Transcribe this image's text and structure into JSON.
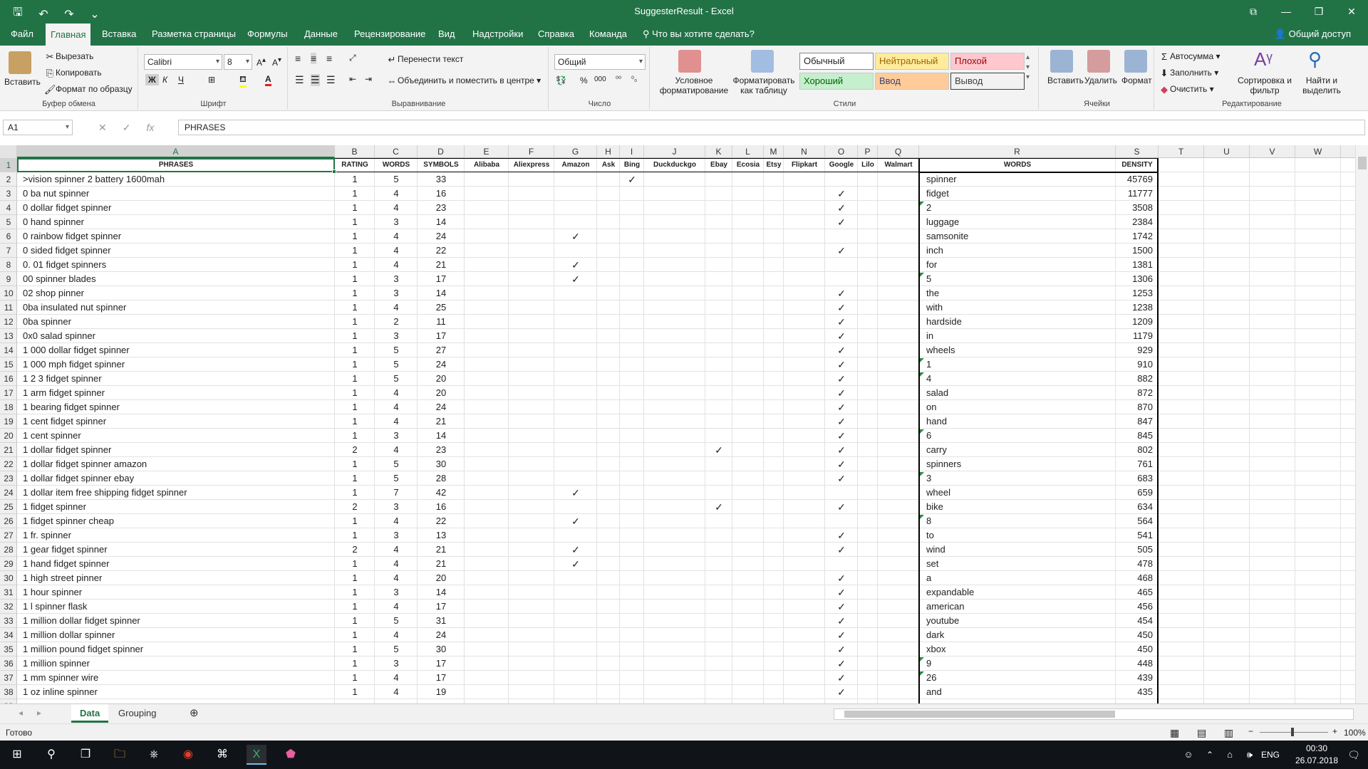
{
  "title": "SuggesterResult  -  Excel",
  "qat": {
    "save": "🖫",
    "undo": "↶",
    "redo": "↷",
    "customize": "⌄"
  },
  "window_controls": [
    "⧉",
    "—",
    "❐",
    "✕"
  ],
  "menu": {
    "tabs": [
      "Файл",
      "Главная",
      "Вставка",
      "Разметка страницы",
      "Формулы",
      "Данные",
      "Рецензирование",
      "Вид",
      "Надстройки",
      "Справка",
      "Команда"
    ],
    "active": "Главная",
    "tell_me": "Что вы хотите сделать?",
    "share": "Общий доступ"
  },
  "ribbon": {
    "clipboard": {
      "label": "Буфер обмена",
      "paste": "Вставить",
      "cut": "Вырезать",
      "copy": "Копировать",
      "format_painter": "Формат по образцу"
    },
    "font": {
      "label": "Шрифт",
      "name": "Calibri",
      "size": "8",
      "bold": "Ж",
      "italic": "К",
      "underline": "Ч"
    },
    "alignment": {
      "label": "Выравнивание",
      "wrap": "Перенести текст",
      "merge": "Объединить и поместить в центре"
    },
    "number": {
      "label": "Число",
      "format": "Общий"
    },
    "styles": {
      "label": "Стили",
      "conditional": "Условное форматирование",
      "as_table": "Форматировать как таблицу",
      "normal": "Обычный",
      "neutral": "Нейтральный",
      "bad": "Плохой",
      "good": "Хороший",
      "input": "Ввод",
      "output": "Вывод"
    },
    "cells": {
      "label": "Ячейки",
      "insert": "Вставить",
      "delete": "Удалить",
      "format": "Формат"
    },
    "editing": {
      "label": "Редактирование",
      "autosum": "Автосумма",
      "fill": "Заполнить",
      "clear": "Очистить",
      "sort": "Сортировка и фильтр",
      "find": "Найти и выделить"
    }
  },
  "name_box": "A1",
  "formula_value": "PHRASES",
  "columns": [
    "A",
    "B",
    "C",
    "D",
    "E",
    "F",
    "G",
    "H",
    "I",
    "J",
    "K",
    "L",
    "M",
    "N",
    "O",
    "P",
    "Q",
    "R",
    "S",
    "T",
    "U",
    "V",
    "W"
  ],
  "headers": {
    "A": "PHRASES",
    "B": "RATING",
    "C": "WORDS",
    "D": "SYMBOLS",
    "E": "Alibaba",
    "F": "Aliexpress",
    "G": "Amazon",
    "H": "Ask",
    "I": "Bing",
    "J": "Duckduckgo",
    "K": "Ebay",
    "L": "Ecosia",
    "M": "Etsy",
    "N": "Flipkart",
    "O": "Google",
    "P": "Lilo",
    "Q": "Walmart",
    "R": "WORDS",
    "S": "DENSITY"
  },
  "check_mark": "✓",
  "rows": [
    {
      "phrase": ">vision spinner 2 battery 1600mah",
      "rating": "1",
      "words": "5",
      "symbols": "33",
      "checks": [
        "I"
      ],
      "word": "spinner",
      "density": "45769"
    },
    {
      "phrase": "0 ba nut spinner",
      "rating": "1",
      "words": "4",
      "symbols": "16",
      "checks": [
        "O"
      ],
      "word": "fidget",
      "density": "11777"
    },
    {
      "phrase": "0 dollar fidget spinner",
      "rating": "1",
      "words": "4",
      "symbols": "23",
      "checks": [
        "O"
      ],
      "word": "2",
      "density": "3508"
    },
    {
      "phrase": "0 hand spinner",
      "rating": "1",
      "words": "3",
      "symbols": "14",
      "checks": [
        "O"
      ],
      "word": "luggage",
      "density": "2384"
    },
    {
      "phrase": "0 rainbow fidget spinner",
      "rating": "1",
      "words": "4",
      "symbols": "24",
      "checks": [
        "G"
      ],
      "word": "samsonite",
      "density": "1742"
    },
    {
      "phrase": "0 sided fidget spinner",
      "rating": "1",
      "words": "4",
      "symbols": "22",
      "checks": [
        "O"
      ],
      "word": "inch",
      "density": "1500"
    },
    {
      "phrase": "0. 01 fidget spinners",
      "rating": "1",
      "words": "4",
      "symbols": "21",
      "checks": [
        "G"
      ],
      "word": "for",
      "density": "1381"
    },
    {
      "phrase": "00 spinner blades",
      "rating": "1",
      "words": "3",
      "symbols": "17",
      "checks": [
        "G"
      ],
      "word": "5",
      "density": "1306"
    },
    {
      "phrase": "02 shop pinner",
      "rating": "1",
      "words": "3",
      "symbols": "14",
      "checks": [
        "O"
      ],
      "word": "the",
      "density": "1253"
    },
    {
      "phrase": "0ba insulated nut spinner",
      "rating": "1",
      "words": "4",
      "symbols": "25",
      "checks": [
        "O"
      ],
      "word": "with",
      "density": "1238"
    },
    {
      "phrase": "0ba spinner",
      "rating": "1",
      "words": "2",
      "symbols": "11",
      "checks": [
        "O"
      ],
      "word": "hardside",
      "density": "1209"
    },
    {
      "phrase": "0x0 salad spinner",
      "rating": "1",
      "words": "3",
      "symbols": "17",
      "checks": [
        "O"
      ],
      "word": "in",
      "density": "1179"
    },
    {
      "phrase": "1 000 dollar fidget spinner",
      "rating": "1",
      "words": "5",
      "symbols": "27",
      "checks": [
        "O"
      ],
      "word": "wheels",
      "density": "929"
    },
    {
      "phrase": "1 000 mph fidget spinner",
      "rating": "1",
      "words": "5",
      "symbols": "24",
      "checks": [
        "O"
      ],
      "word": "1",
      "density": "910"
    },
    {
      "phrase": "1 2 3 fidget spinner",
      "rating": "1",
      "words": "5",
      "symbols": "20",
      "checks": [
        "O"
      ],
      "word": "4",
      "density": "882"
    },
    {
      "phrase": "1 arm fidget spinner",
      "rating": "1",
      "words": "4",
      "symbols": "20",
      "checks": [
        "O"
      ],
      "word": "salad",
      "density": "872"
    },
    {
      "phrase": "1 bearing fidget spinner",
      "rating": "1",
      "words": "4",
      "symbols": "24",
      "checks": [
        "O"
      ],
      "word": "on",
      "density": "870"
    },
    {
      "phrase": "1 cent fidget spinner",
      "rating": "1",
      "words": "4",
      "symbols": "21",
      "checks": [
        "O"
      ],
      "word": "hand",
      "density": "847"
    },
    {
      "phrase": "1 cent spinner",
      "rating": "1",
      "words": "3",
      "symbols": "14",
      "checks": [
        "O"
      ],
      "word": "6",
      "density": "845"
    },
    {
      "phrase": "1 dollar fidget spinner",
      "rating": "2",
      "words": "4",
      "symbols": "23",
      "checks": [
        "K",
        "O"
      ],
      "word": "carry",
      "density": "802"
    },
    {
      "phrase": "1 dollar fidget spinner amazon",
      "rating": "1",
      "words": "5",
      "symbols": "30",
      "checks": [
        "O"
      ],
      "word": "spinners",
      "density": "761"
    },
    {
      "phrase": "1 dollar fidget spinner ebay",
      "rating": "1",
      "words": "5",
      "symbols": "28",
      "checks": [
        "O"
      ],
      "word": "3",
      "density": "683"
    },
    {
      "phrase": "1 dollar item free shipping fidget spinner",
      "rating": "1",
      "words": "7",
      "symbols": "42",
      "checks": [
        "G"
      ],
      "word": "wheel",
      "density": "659"
    },
    {
      "phrase": "1 fidget spinner",
      "rating": "2",
      "words": "3",
      "symbols": "16",
      "checks": [
        "K",
        "O"
      ],
      "word": "bike",
      "density": "634"
    },
    {
      "phrase": "1 fidget spinner cheap",
      "rating": "1",
      "words": "4",
      "symbols": "22",
      "checks": [
        "G"
      ],
      "word": "8",
      "density": "564"
    },
    {
      "phrase": "1 fr. spinner",
      "rating": "1",
      "words": "3",
      "symbols": "13",
      "checks": [
        "O"
      ],
      "word": "to",
      "density": "541"
    },
    {
      "phrase": "1 gear fidget spinner",
      "rating": "2",
      "words": "4",
      "symbols": "21",
      "checks": [
        "G",
        "O"
      ],
      "word": "wind",
      "density": "505"
    },
    {
      "phrase": "1 hand fidget spinner",
      "rating": "1",
      "words": "4",
      "symbols": "21",
      "checks": [
        "G"
      ],
      "word": "set",
      "density": "478"
    },
    {
      "phrase": "1 high street pinner",
      "rating": "1",
      "words": "4",
      "symbols": "20",
      "checks": [
        "O"
      ],
      "word": "a",
      "density": "468"
    },
    {
      "phrase": "1 hour spinner",
      "rating": "1",
      "words": "3",
      "symbols": "14",
      "checks": [
        "O"
      ],
      "word": "expandable",
      "density": "465"
    },
    {
      "phrase": "1 l spinner flask",
      "rating": "1",
      "words": "4",
      "symbols": "17",
      "checks": [
        "O"
      ],
      "word": "american",
      "density": "456"
    },
    {
      "phrase": "1 million dollar fidget spinner",
      "rating": "1",
      "words": "5",
      "symbols": "31",
      "checks": [
        "O"
      ],
      "word": "youtube",
      "density": "454"
    },
    {
      "phrase": "1 million dollar spinner",
      "rating": "1",
      "words": "4",
      "symbols": "24",
      "checks": [
        "O"
      ],
      "word": "dark",
      "density": "450"
    },
    {
      "phrase": "1 million pound fidget spinner",
      "rating": "1",
      "words": "5",
      "symbols": "30",
      "checks": [
        "O"
      ],
      "word": "xbox",
      "density": "450"
    },
    {
      "phrase": "1 million spinner",
      "rating": "1",
      "words": "3",
      "symbols": "17",
      "checks": [
        "O"
      ],
      "word": "9",
      "density": "448"
    },
    {
      "phrase": "1 mm spinner wire",
      "rating": "1",
      "words": "4",
      "symbols": "17",
      "checks": [
        "O"
      ],
      "word": "26",
      "density": "439"
    },
    {
      "phrase": "1 oz inline spinner",
      "rating": "1",
      "words": "4",
      "symbols": "19",
      "checks": [
        "O"
      ],
      "word": "and",
      "density": "435"
    }
  ],
  "sheets": {
    "tabs": [
      "Data",
      "Grouping"
    ],
    "active": "Data",
    "add": "⊕"
  },
  "status": {
    "ready": "Готово",
    "zoom": "100%"
  },
  "taskbar": {
    "lang": "ENG",
    "time": "00:30",
    "date": "26.07.2018"
  }
}
